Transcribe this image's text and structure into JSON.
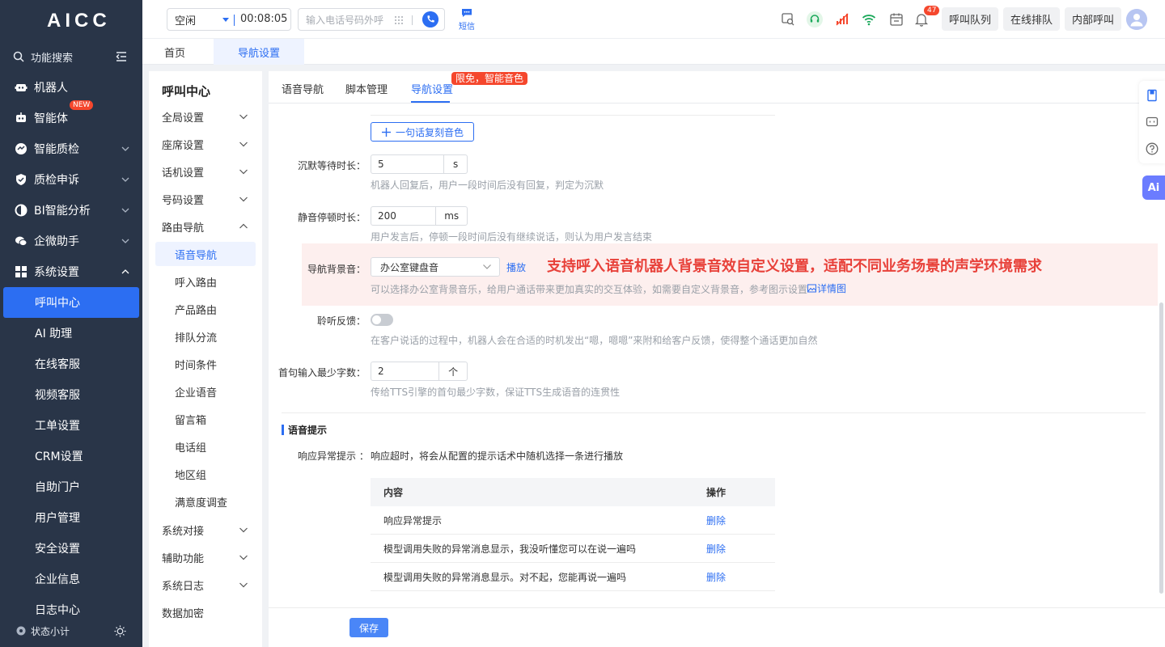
{
  "app": {
    "logo": "AICC"
  },
  "sidebar": {
    "search_label": "功能搜索",
    "items": [
      {
        "label": "机器人",
        "icon": "robot-icon"
      },
      {
        "label": "智能体",
        "icon": "agent-icon",
        "badge": "NEW"
      },
      {
        "label": "智能质检",
        "icon": "quality-icon"
      },
      {
        "label": "质检申诉",
        "icon": "shield-icon"
      },
      {
        "label": "BI智能分析",
        "icon": "pie-chart-icon"
      },
      {
        "label": "企微助手",
        "icon": "wechat-icon"
      },
      {
        "label": "系统设置",
        "icon": "grid-icon"
      }
    ],
    "sub_items": [
      "呼叫中心",
      "AI 助理",
      "在线客服",
      "视频客服",
      "工单设置",
      "CRM设置",
      "自助门户",
      "用户管理",
      "安全设置",
      "企业信息",
      "日志中心"
    ],
    "footer_label": "状态小计"
  },
  "topbar": {
    "status": "空闲",
    "timer": "00:08:05",
    "phone_placeholder": "输入电话号码外呼",
    "sms_label": "短信",
    "notification_count": "47",
    "buttons": [
      "呼叫队列",
      "在线排队",
      "内部呼叫"
    ]
  },
  "page_tabs": [
    "首页",
    "导航设置"
  ],
  "left_nav": {
    "title": "呼叫中心",
    "groups_top": [
      "全局设置",
      "座席设置",
      "话机设置",
      "号码设置",
      "路由导航"
    ],
    "sub_items": [
      "语音导航",
      "呼入路由",
      "产品路由",
      "排队分流",
      "时间条件",
      "企业语音",
      "留言箱",
      "电话组",
      "地区组",
      "满意度调查"
    ],
    "groups_bottom": [
      "系统对接",
      "辅助功能",
      "系统日志"
    ],
    "last_item": "数据加密"
  },
  "content": {
    "tabs": [
      "语音导航",
      "脚本管理",
      "导航设置"
    ],
    "promo_badge": "限免，智能音色",
    "clone_voice_button": "一句话复刻音色",
    "silence_wait": {
      "label": "沉默等待时长：",
      "value": "5",
      "unit": "s",
      "hint": "机器人回复后，用户一段时间后没有回复，判定为沉默"
    },
    "mute_pause": {
      "label": "静音停顿时长：",
      "value": "200",
      "unit": "ms",
      "hint": "用户发言后，停顿一段时间后没有继续说话，则认为用户发言结束"
    },
    "bg_sound": {
      "label": "导航背景音：",
      "value": "办公室键盘音",
      "play": "播放",
      "hint": "可以选择办公室背景音乐，给用户通话带来更加真实的交互体验，如需要自定义背景音，参考图示设置",
      "detail_link": "详情图",
      "annotation": "支持呼入语音机器人背景音效自定义设置，适配不同业务场景的声学环境需求"
    },
    "listen_feedback": {
      "label": "聆听反馈：",
      "enabled": false,
      "hint": "在客户说话的过程中，机器人会在合适的时机发出“嗯，嗯嗯”来附和给客户反馈，使得整个通话更加自然"
    },
    "first_min_chars": {
      "label": "首句输入最少字数：",
      "value": "2",
      "unit": "个",
      "hint": "传给TTS引擎的首句最少字数，保证TTS生成语音的连贯性"
    },
    "section_title": "语音提示",
    "response_label": "响应异常提示 ：",
    "response_text": "响应超时，将会从配置的提示话术中随机选择一条进行播放",
    "table": {
      "headers": [
        "内容",
        "操作"
      ],
      "rows": [
        {
          "content": "响应异常提示",
          "action": "删除"
        },
        {
          "content": "模型调用失败的异常消息显示，我没听懂您可以在说一遍吗",
          "action": "删除"
        },
        {
          "content": "模型调用失败的异常消息显示。对不起，您能再说一遍吗",
          "action": "删除"
        }
      ]
    },
    "save_button": "保存"
  },
  "float_tools": {
    "ai_label": "Ai"
  },
  "colors": {
    "primary": "#2c6ef2",
    "sidebar_bg": "#293548",
    "danger": "#f5472d",
    "highlight_bg": "#fdefee"
  }
}
